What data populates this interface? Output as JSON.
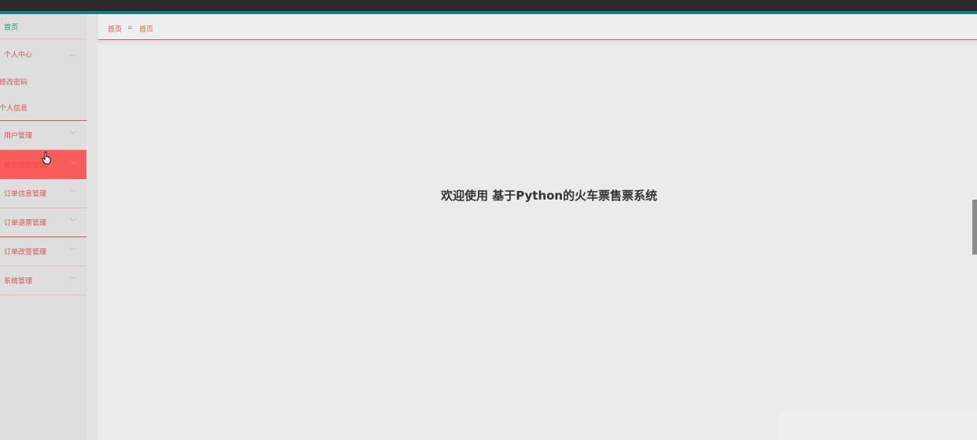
{
  "sidebar": {
    "home": "首页",
    "personal": {
      "label": "个人中心",
      "sub": [
        "修改密码",
        "个人信息"
      ]
    },
    "items": [
      "用户管理",
      "票务信息管理",
      "订单信息管理",
      "订单退票管理",
      "订单改签管理",
      "系统管理"
    ]
  },
  "breadcrumb": {
    "home": "首页",
    "current": "首页"
  },
  "main": {
    "welcome": "欢迎使用 基于Python的火车票售票系统"
  },
  "colors": {
    "topbar": "#2b2b2b",
    "accent": "#137e84",
    "menu_text": "#d9534f",
    "active_bg": "#fb5c5c",
    "home_text": "#1a9a6a"
  },
  "icons": {
    "chevron_up": "chevron-up-icon",
    "chevron_down": "chevron-down-icon",
    "breadcrumb_sep": "home-icon",
    "pointer": "hand-pointer-icon"
  }
}
